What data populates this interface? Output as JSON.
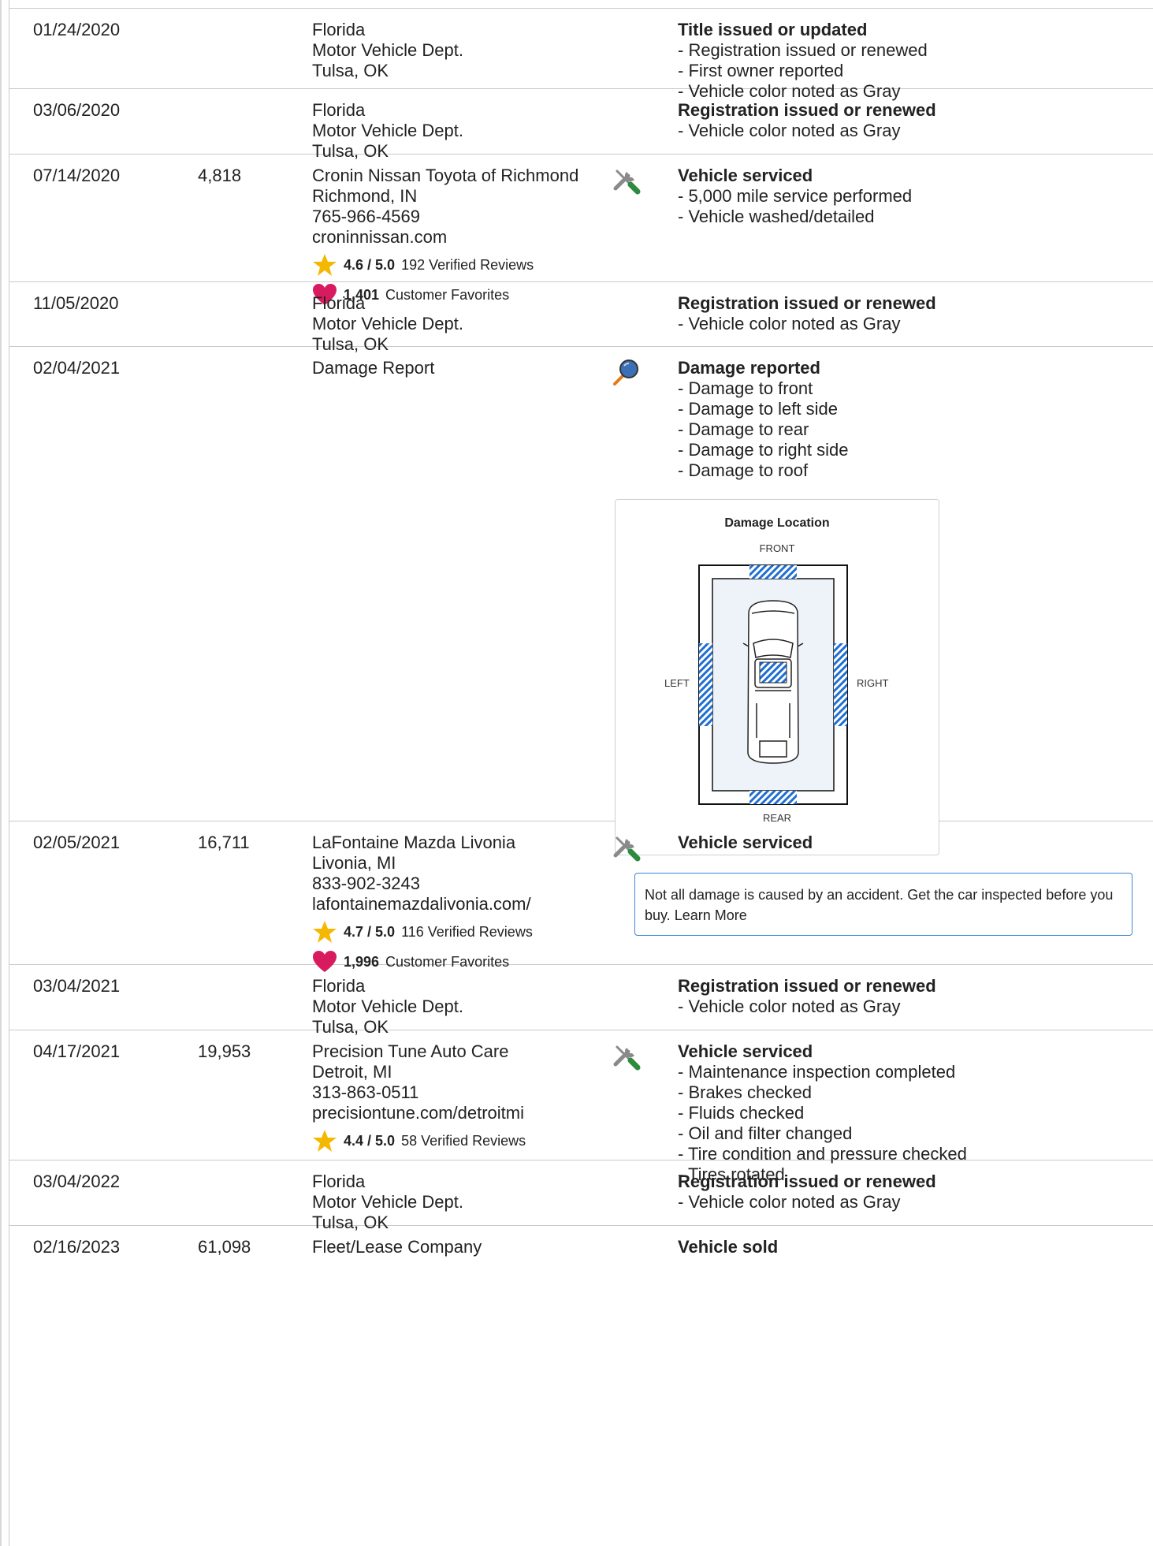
{
  "rows": [
    {
      "date": "01/24/2020",
      "mileage": "",
      "source": [
        "Florida",
        "Motor Vehicle Dept.",
        "Tulsa, OK"
      ],
      "icon": "",
      "title": "Title issued or updated",
      "items": [
        "- Registration issued or renewed",
        "- First owner reported",
        "- Vehicle color noted as Gray"
      ]
    },
    {
      "date": "03/06/2020",
      "mileage": "",
      "source": [
        "Florida",
        "Motor Vehicle Dept.",
        "Tulsa, OK"
      ],
      "icon": "",
      "title": "Registration issued or renewed",
      "items": [
        "- Vehicle color noted as Gray"
      ]
    },
    {
      "date": "07/14/2020",
      "mileage": "4,818",
      "source": [
        "Cronin Nissan Toyota of Richmond",
        "Richmond, IN",
        "765-966-4569",
        "croninnissan.com"
      ],
      "rating": {
        "score": "4.6 / 5.0",
        "reviews": "192 Verified Reviews"
      },
      "favorites": {
        "count": "1,401",
        "label": "Customer Favorites"
      },
      "icon": "wrench-screwdriver-icon",
      "title": "Vehicle serviced",
      "items": [
        "- 5,000 mile service performed",
        "- Vehicle washed/detailed"
      ]
    },
    {
      "date": "11/05/2020",
      "mileage": "",
      "source": [
        "Florida",
        "Motor Vehicle Dept.",
        "Tulsa, OK"
      ],
      "icon": "",
      "title": "Registration issued or renewed",
      "items": [
        "- Vehicle color noted as Gray"
      ]
    },
    {
      "date": "02/04/2021",
      "mileage": "",
      "source": [
        "Damage Report"
      ],
      "icon": "magnifier-icon",
      "title": "Damage reported",
      "items": [
        "- Damage to front",
        "- Damage to left side",
        "- Damage to rear",
        "- Damage to right side",
        "- Damage to roof"
      ]
    },
    {
      "date": "02/05/2021",
      "mileage": "16,711",
      "source": [
        "LaFontaine Mazda Livonia",
        "Livonia, MI",
        "833-902-3243",
        "lafontainemazdalivonia.com/"
      ],
      "rating": {
        "score": "4.7 / 5.0",
        "reviews": "116 Verified Reviews"
      },
      "favorites": {
        "count": "1,996",
        "label": "Customer Favorites"
      },
      "icon": "wrench-screwdriver-icon",
      "title": "Vehicle serviced",
      "items": []
    },
    {
      "date": "03/04/2021",
      "mileage": "",
      "source": [
        "Florida",
        "Motor Vehicle Dept.",
        "Tulsa, OK"
      ],
      "icon": "",
      "title": "Registration issued or renewed",
      "items": [
        "- Vehicle color noted as Gray"
      ]
    },
    {
      "date": "04/17/2021",
      "mileage": "19,953",
      "source": [
        "Precision Tune Auto Care",
        "Detroit, MI",
        "313-863-0511",
        "precisiontune.com/detroitmi"
      ],
      "rating": {
        "score": "4.4 / 5.0",
        "reviews": "58 Verified Reviews"
      },
      "icon": "wrench-screwdriver-icon",
      "title": "Vehicle serviced",
      "items": [
        "- Maintenance inspection completed",
        "- Brakes checked",
        "- Fluids checked",
        "- Oil and filter changed",
        "- Tire condition and pressure checked",
        "- Tires rotated"
      ]
    },
    {
      "date": "03/04/2022",
      "mileage": "",
      "source": [
        "Florida",
        "Motor Vehicle Dept.",
        "Tulsa, OK"
      ],
      "icon": "",
      "title": "Registration issued or renewed",
      "items": [
        "- Vehicle color noted as Gray"
      ]
    },
    {
      "date": "02/16/2023",
      "mileage": "61,098",
      "source": [
        "Fleet/Lease Company"
      ],
      "icon": "",
      "title": "Vehicle sold",
      "items": []
    }
  ],
  "damage_diagram": {
    "title": "Damage Location",
    "front": "FRONT",
    "rear": "REAR",
    "left": "LEFT",
    "right": "RIGHT",
    "damaged_areas": [
      "front",
      "rear",
      "left",
      "right",
      "roof"
    ],
    "highlight_color": "#1f6fd1"
  },
  "notice": "Not all damage is caused by an accident. Get the car inspected before you buy. Learn More",
  "colors": {
    "star": "#f5b800",
    "heart": "#d81b5e",
    "screwdriver": "#2e8b3e",
    "magnifier_lens": "#3b6fb6",
    "magnifier_handle": "#e07b1a"
  }
}
